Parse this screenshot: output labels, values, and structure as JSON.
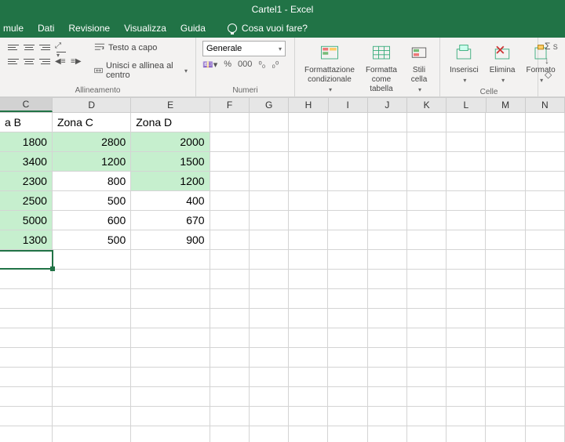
{
  "titlebar": {
    "text": "Cartel1 - Excel"
  },
  "menu": {
    "items": [
      "mule",
      "Dati",
      "Revisione",
      "Visualizza",
      "Guida"
    ],
    "help": "Cosa vuoi fare?"
  },
  "ribbon": {
    "alignment": {
      "wrap": "Testo a capo",
      "merge": "Unisci e allinea al centro",
      "label": "Allineamento"
    },
    "number": {
      "format": "Generale",
      "label": "Numeri"
    },
    "styles": {
      "conditional": "Formattazione\ncondizionale",
      "astable": "Formatta come\ntabella",
      "cellstyles": "Stili\ncella",
      "label": "Stili"
    },
    "cells": {
      "insert": "Inserisci",
      "delete": "Elimina",
      "format": "Formato",
      "label": "Celle"
    }
  },
  "columns": [
    "C",
    "D",
    "E",
    "F",
    "G",
    "H",
    "I",
    "J",
    "K",
    "L",
    "M",
    "N"
  ],
  "headers": {
    "C": "a B",
    "D": "Zona C",
    "E": "Zona D"
  },
  "data": [
    {
      "C": 1800,
      "D": 2800,
      "E": 2000,
      "hl": [
        "C",
        "D",
        "E"
      ]
    },
    {
      "C": 3400,
      "D": 1200,
      "E": 1500,
      "hl": [
        "C",
        "D",
        "E"
      ]
    },
    {
      "C": 2300,
      "D": 800,
      "E": 1200,
      "hl": [
        "C",
        "E"
      ]
    },
    {
      "C": 2500,
      "D": 500,
      "E": 400,
      "hl": [
        "C"
      ]
    },
    {
      "C": 5000,
      "D": 600,
      "E": 670,
      "hl": [
        "C"
      ]
    },
    {
      "C": 1300,
      "D": 500,
      "E": 900,
      "hl": [
        "C"
      ]
    }
  ],
  "chart_data": {
    "type": "table",
    "columns": [
      "Zona B (partial)",
      "Zona C",
      "Zona D"
    ],
    "rows": [
      [
        1800,
        2800,
        2000
      ],
      [
        3400,
        1200,
        1500
      ],
      [
        2300,
        800,
        1200
      ],
      [
        2500,
        500,
        400
      ],
      [
        5000,
        600,
        670
      ],
      [
        1300,
        500,
        900
      ]
    ],
    "highlighted_green": "Column C fully; D rows 1-2; E rows 1-3"
  }
}
